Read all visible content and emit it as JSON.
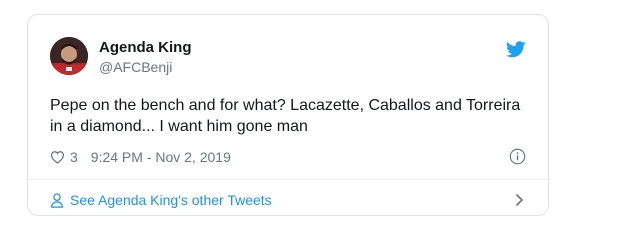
{
  "tweet": {
    "author": {
      "display_name": "Agenda King",
      "handle": "@AFCBenji"
    },
    "text": "Pepe on the bench and for what? Lacazette, Caballos and Torreira in a diamond... I want him gone man",
    "likes": "3",
    "timestamp": "9:24 PM - Nov 2, 2019"
  },
  "footer": {
    "link_label": "See Agenda King's other Tweets"
  },
  "icons": {
    "logo": "twitter-bird-icon",
    "like": "heart-icon",
    "info": "info-icon",
    "profile": "person-icon",
    "next": "chevron-right-icon"
  },
  "colors": {
    "twitter_blue": "#1da1f2",
    "link_blue": "#1b95e0",
    "text_primary": "#14171a",
    "text_secondary": "#657786"
  }
}
